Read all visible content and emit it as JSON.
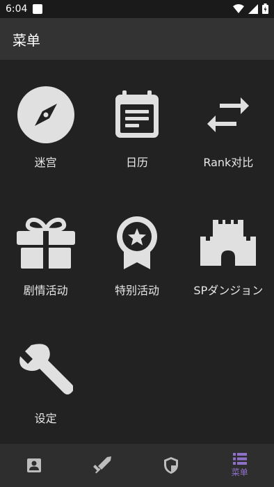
{
  "status_bar": {
    "time": "6:04",
    "icons": [
      "notification-icon",
      "wifi-icon",
      "signal-icon",
      "battery-icon"
    ]
  },
  "app_bar": {
    "title": "菜单"
  },
  "menu_items": [
    {
      "label": "迷宫",
      "icon": "compass-icon"
    },
    {
      "label": "日历",
      "icon": "calendar-icon"
    },
    {
      "label": "Rank对比",
      "icon": "swap-arrows-icon"
    },
    {
      "label": "剧情活动",
      "icon": "gift-icon"
    },
    {
      "label": "特别活动",
      "icon": "award-badge-icon"
    },
    {
      "label": "SPダンジョン",
      "icon": "castle-icon"
    },
    {
      "label": "设定",
      "icon": "wrench-icon"
    }
  ],
  "bottom_nav": {
    "items": [
      {
        "icon": "profile-card-icon",
        "label": ""
      },
      {
        "icon": "sword-icon",
        "label": ""
      },
      {
        "icon": "shield-icon",
        "label": ""
      },
      {
        "icon": "list-icon",
        "label": "菜单",
        "active": true
      }
    ]
  },
  "colors": {
    "background": "#222222",
    "app_bar": "#333333",
    "icon": "#e0e0e0",
    "nav_inactive": "#bdbdbd",
    "nav_active": "#8f71c9"
  }
}
